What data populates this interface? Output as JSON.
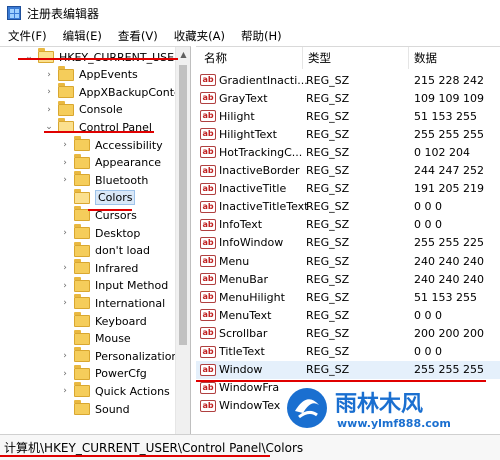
{
  "window": {
    "title": "注册表编辑器",
    "app_icon": "registry-editor-icon"
  },
  "menu": [
    "文件(F)",
    "编辑(E)",
    "查看(V)",
    "收藏夹(A)",
    "帮助(H)"
  ],
  "tree": {
    "items": [
      {
        "label": "HKEY_CURRENT_USER",
        "level": 0,
        "expanded": true
      },
      {
        "label": "AppEvents",
        "level": 1,
        "expanded": false
      },
      {
        "label": "AppXBackupConter",
        "level": 1,
        "expanded": false
      },
      {
        "label": "Console",
        "level": 1,
        "expanded": false
      },
      {
        "label": "Control Panel",
        "level": 1,
        "expanded": true
      },
      {
        "label": "Accessibility",
        "level": 2,
        "expanded": false
      },
      {
        "label": "Appearance",
        "level": 2,
        "expanded": false
      },
      {
        "label": "Bluetooth",
        "level": 2,
        "expanded": false
      },
      {
        "label": "Colors",
        "level": 2,
        "selected": true
      },
      {
        "label": "Cursors",
        "level": 2
      },
      {
        "label": "Desktop",
        "level": 2,
        "expanded": false
      },
      {
        "label": "don't load",
        "level": 2
      },
      {
        "label": "Infrared",
        "level": 2,
        "expanded": false
      },
      {
        "label": "Input Method",
        "level": 2,
        "expanded": false
      },
      {
        "label": "International",
        "level": 2,
        "expanded": false
      },
      {
        "label": "Keyboard",
        "level": 2
      },
      {
        "label": "Mouse",
        "level": 2
      },
      {
        "label": "Personalization",
        "level": 2,
        "expanded": false
      },
      {
        "label": "PowerCfg",
        "level": 2,
        "expanded": false
      },
      {
        "label": "Quick Actions",
        "level": 2,
        "expanded": false
      },
      {
        "label": "Sound",
        "level": 2
      }
    ]
  },
  "values": {
    "columns": {
      "name": "名称",
      "type": "类型",
      "data": "数据"
    },
    "rows": [
      {
        "name": "GradientInacti...",
        "type": "REG_SZ",
        "data": "215 228 242"
      },
      {
        "name": "GrayText",
        "type": "REG_SZ",
        "data": "109 109 109"
      },
      {
        "name": "Hilight",
        "type": "REG_SZ",
        "data": "51 153 255"
      },
      {
        "name": "HilightText",
        "type": "REG_SZ",
        "data": "255 255 255"
      },
      {
        "name": "HotTrackingC...",
        "type": "REG_SZ",
        "data": "0 102 204"
      },
      {
        "name": "InactiveBorder",
        "type": "REG_SZ",
        "data": "244 247 252"
      },
      {
        "name": "InactiveTitle",
        "type": "REG_SZ",
        "data": "191 205 219"
      },
      {
        "name": "InactiveTitleText",
        "type": "REG_SZ",
        "data": "0 0 0"
      },
      {
        "name": "InfoText",
        "type": "REG_SZ",
        "data": "0 0 0"
      },
      {
        "name": "InfoWindow",
        "type": "REG_SZ",
        "data": "255 255 225"
      },
      {
        "name": "Menu",
        "type": "REG_SZ",
        "data": "240 240 240"
      },
      {
        "name": "MenuBar",
        "type": "REG_SZ",
        "data": "240 240 240"
      },
      {
        "name": "MenuHilight",
        "type": "REG_SZ",
        "data": "51 153 255"
      },
      {
        "name": "MenuText",
        "type": "REG_SZ",
        "data": "0 0 0"
      },
      {
        "name": "Scrollbar",
        "type": "REG_SZ",
        "data": "200 200 200"
      },
      {
        "name": "TitleText",
        "type": "REG_SZ",
        "data": "0 0 0"
      },
      {
        "name": "Window",
        "type": "REG_SZ",
        "data": "255 255 255",
        "highlighted": true
      },
      {
        "name": "WindowFra",
        "type": "",
        "data": ""
      },
      {
        "name": "WindowTex",
        "type": "",
        "data": ""
      }
    ],
    "value_icon": "ab"
  },
  "statusbar": {
    "path": "计算机\\HKEY_CURRENT_USER\\Control Panel\\Colors"
  },
  "watermark": {
    "brand": "雨林木风",
    "url": "www.ylmf888.com"
  },
  "colors": {
    "annotation_red": "#e00000",
    "logo_blue": "#1a6fd0",
    "folder_yellow": "#f5cd5b"
  }
}
